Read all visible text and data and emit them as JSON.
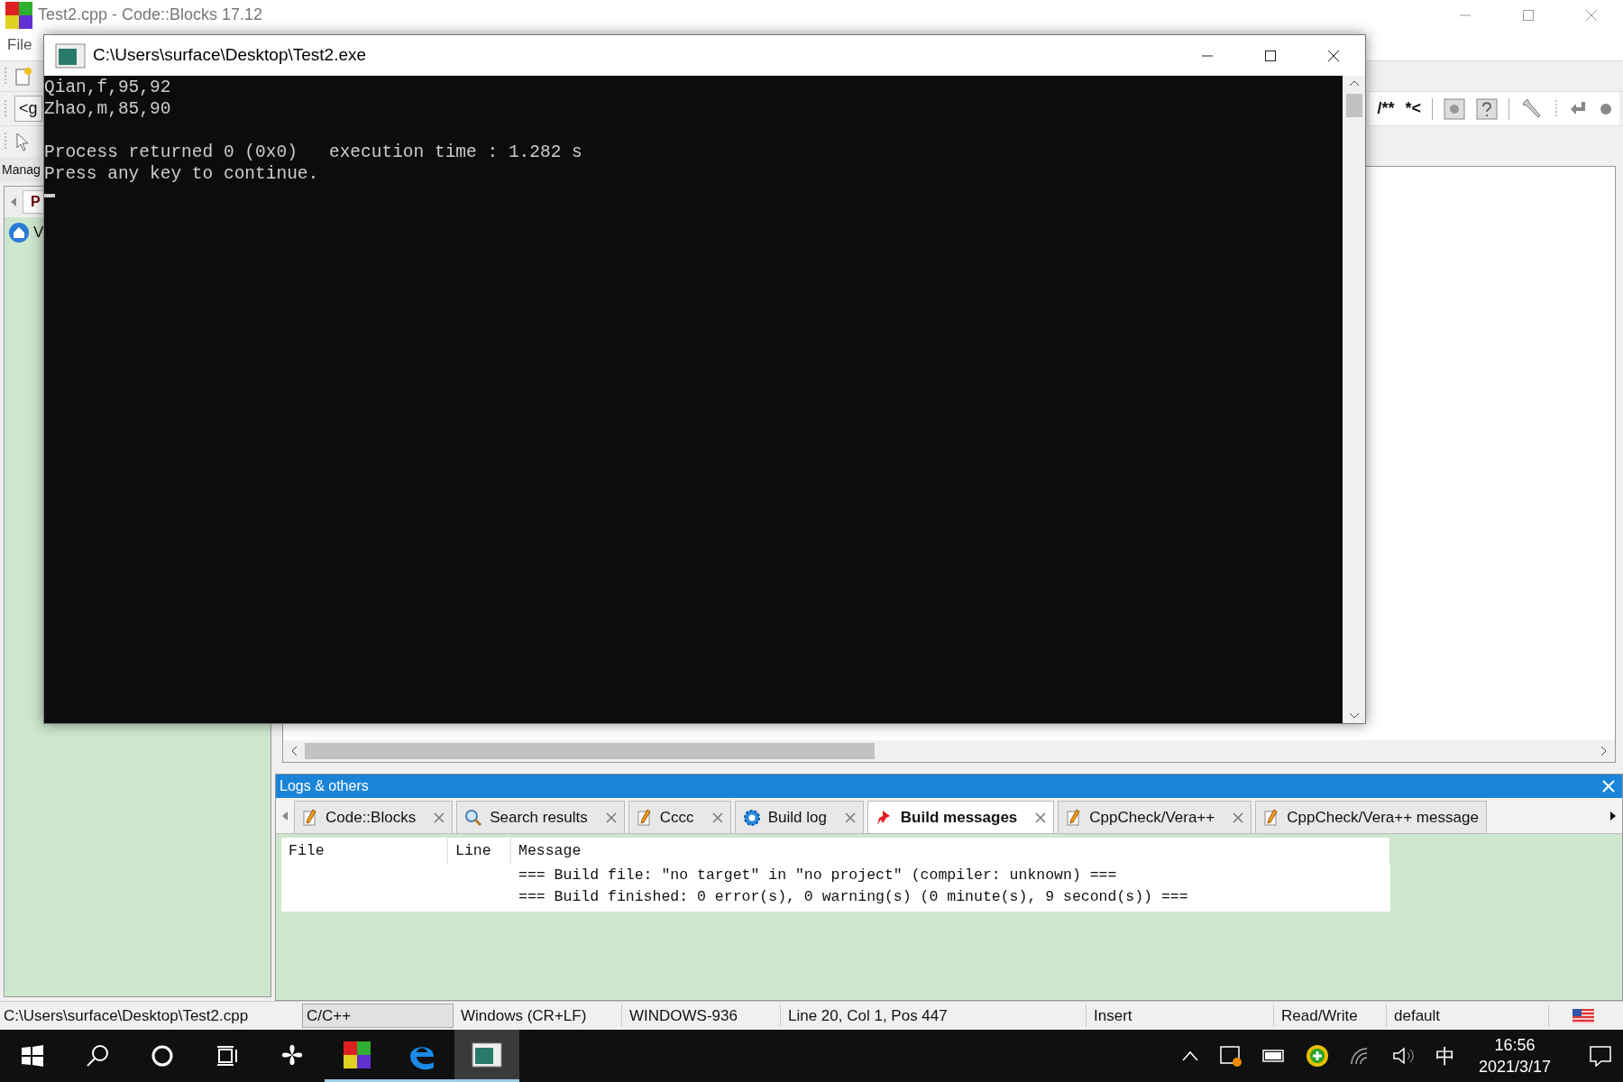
{
  "ide": {
    "title": "Test2.cpp - Code::Blocks 17.12",
    "menu": [
      "File"
    ],
    "search_fragment": "<g",
    "comment_tools": [
      "/**",
      "*<"
    ],
    "management": {
      "tab": "Manag",
      "notebook_tab": "P",
      "tree_item": "V"
    }
  },
  "console": {
    "title": "C:\\Users\\surface\\Desktop\\Test2.exe",
    "output": [
      "Qian,f,95,92",
      "Zhao,m,85,90"
    ],
    "exit_lines": [
      "Process returned 0 (0x0)   execution time : 1.282 s",
      "Press any key to continue."
    ]
  },
  "logs": {
    "title": "Logs & others",
    "tabs": [
      {
        "label": "Code::Blocks",
        "kind": "pencil",
        "selected": false
      },
      {
        "label": "Search results",
        "kind": "search",
        "selected": false
      },
      {
        "label": "Cccc",
        "kind": "pencil",
        "selected": false
      },
      {
        "label": "Build log",
        "kind": "gear",
        "selected": false
      },
      {
        "label": "Build messages",
        "kind": "pin",
        "selected": true
      },
      {
        "label": "CppCheck/Vera++",
        "kind": "pencil",
        "selected": false
      },
      {
        "label": "CppCheck/Vera++ message",
        "kind": "pencil",
        "selected": false
      }
    ],
    "columns": [
      "File",
      "Line",
      "Message"
    ],
    "rows": [
      {
        "message": "=== Build file: \"no target\" in \"no project\" (compiler: unknown) ==="
      },
      {
        "message": "=== Build finished: 0 error(s), 0 warning(s) (0 minute(s), 9 second(s)) ==="
      }
    ]
  },
  "status_bar": {
    "file": "C:\\Users\\surface\\Desktop\\Test2.cpp",
    "language": "C/C++",
    "line_endings": "Windows (CR+LF)",
    "encoding": "WINDOWS-936",
    "position": "Line 20, Col 1, Pos 447",
    "mode": "Insert",
    "access": "Read/Write",
    "profile": "default"
  },
  "taskbar": {
    "apps": [
      {
        "kind": "pinwheel",
        "active": false,
        "running": false
      },
      {
        "kind": "codeblocks",
        "active": false,
        "running": true
      },
      {
        "kind": "edge",
        "active": false,
        "running": true
      },
      {
        "kind": "console",
        "active": true,
        "running": true
      }
    ],
    "ime": "中",
    "time": "16:56",
    "date": "2021/3/17"
  }
}
